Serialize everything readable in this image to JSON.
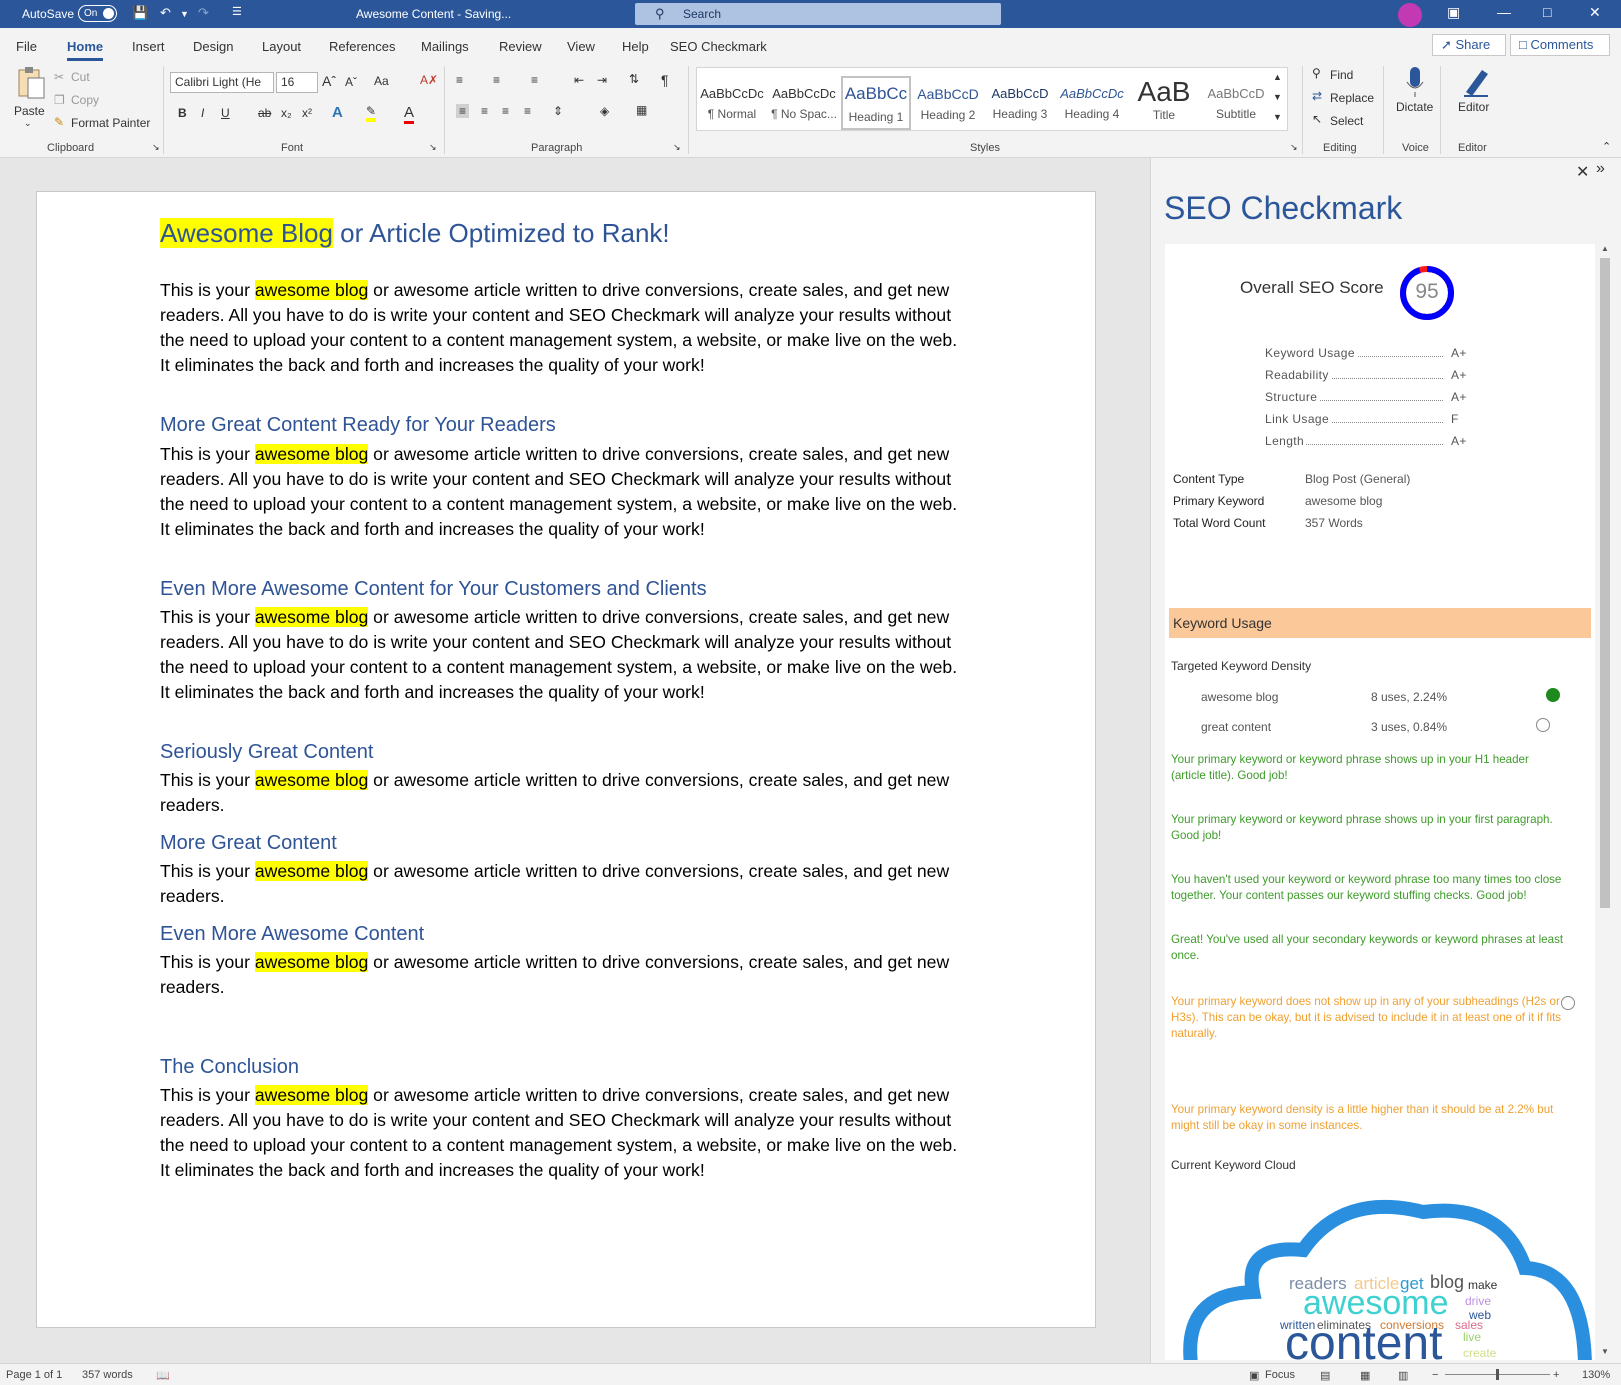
{
  "titlebar": {
    "autosave_label": "AutoSave",
    "autosave_state": "On",
    "doc_title": "Awesome Content - Saving...",
    "search_placeholder": "Search"
  },
  "tabs": [
    "File",
    "Home",
    "Insert",
    "Design",
    "Layout",
    "References",
    "Mailings",
    "Review",
    "View",
    "Help",
    "SEO Checkmark"
  ],
  "share_label": "Share",
  "comments_label": "Comments",
  "ribbon": {
    "clipboard": {
      "paste": "Paste",
      "cut": "Cut",
      "copy": "Copy",
      "format_painter": "Format Painter",
      "label": "Clipboard"
    },
    "font": {
      "name": "Calibri Light (He",
      "size": "16",
      "change_case": "Aa",
      "label": "Font"
    },
    "paragraph": {
      "label": "Paragraph"
    },
    "styles": {
      "label": "Styles",
      "items": [
        {
          "sample": "AaBbCcDc",
          "name": "¶ Normal"
        },
        {
          "sample": "AaBbCcDc",
          "name": "¶ No Spac..."
        },
        {
          "sample": "AaBbCc",
          "name": "Heading 1"
        },
        {
          "sample": "AaBbCcD",
          "name": "Heading 2"
        },
        {
          "sample": "AaBbCcD",
          "name": "Heading 3"
        },
        {
          "sample": "AaBbCcDc",
          "name": "Heading 4"
        },
        {
          "sample": "AaB",
          "name": "Title"
        },
        {
          "sample": "AaBbCcD",
          "name": "Subtitle"
        }
      ]
    },
    "editing": {
      "find": "Find",
      "replace": "Replace",
      "select": "Select",
      "label": "Editing"
    },
    "voice": {
      "dictate": "Dictate",
      "label": "Voice"
    },
    "editor": {
      "editor": "Editor",
      "label": "Editor"
    }
  },
  "document": {
    "title_highlight": "Awesome Blog",
    "title_rest": " or Article Optimized to Rank!",
    "para_pre": "This is your ",
    "keyword": "awesome blog",
    "para_long_rest": " or awesome article written to drive conversions, create sales, and get new readers. All you have to do is write your content and SEO Checkmark will analyze your results without the need to upload your content to a content management system, a website, or make live on the web. It eliminates the back and forth and increases the quality of your work!",
    "para_short_rest": " or awesome article written to drive conversions, create sales, and get new readers.",
    "headings": [
      "More Great Content Ready for Your Readers",
      "Even More Awesome Content for Your Customers and Clients",
      "Seriously Great Content",
      "More Great Content",
      "Even More Awesome Content",
      "The Conclusion"
    ]
  },
  "pane": {
    "title": "SEO Checkmark",
    "overall_label": "Overall SEO Score",
    "score": "95",
    "score_value": 0.95,
    "grades": [
      {
        "label": "Keyword Usage",
        "grade": "A+"
      },
      {
        "label": "Readability",
        "grade": "A+"
      },
      {
        "label": "Structure",
        "grade": "A+"
      },
      {
        "label": "Link Usage",
        "grade": "F"
      },
      {
        "label": "Length",
        "grade": "A+"
      }
    ],
    "info": [
      {
        "label": "Content Type",
        "value": "Blog Post (General)"
      },
      {
        "label": "Primary Keyword",
        "value": "awesome blog"
      },
      {
        "label": "Total Word Count",
        "value": "357 Words"
      }
    ],
    "section_header": "Keyword Usage",
    "density_title": "Targeted Keyword Density",
    "keywords": [
      {
        "name": "awesome blog",
        "stats": "8 uses, 2.24%"
      },
      {
        "name": "great content",
        "stats": "3 uses, 0.84%"
      }
    ],
    "messages": [
      {
        "text": "Your primary keyword or keyword phrase shows up in your H1 header (article title). Good job!",
        "tone": "green"
      },
      {
        "text": "Your primary keyword or keyword phrase shows up in your first paragraph. Good job!",
        "tone": "green"
      },
      {
        "text": "You haven't used your keyword or keyword phrase too many times too close together. Your content passes our keyword stuffing checks. Good job!",
        "tone": "green"
      },
      {
        "text": "Great!  You've used all your secondary keywords or keyword phrases at least once.",
        "tone": "green"
      },
      {
        "text": "Your primary keyword does not show up in any of your subheadings (H2s or H3s).  This can be okay, but it is advised to include it in at least one of it if fits naturally.",
        "tone": "orange"
      },
      {
        "text": "Your primary keyword density is a little higher than it should be at 2.2% but might still be okay in some instances.",
        "tone": "orange"
      }
    ],
    "cloud_title": "Current Keyword Cloud",
    "cloud_words": [
      "readers",
      "article",
      "get",
      "blog",
      "make",
      "awesome",
      "drive",
      "web",
      "written",
      "eliminates",
      "conversions",
      "sales",
      "live",
      "content",
      "create"
    ]
  },
  "status": {
    "page": "Page 1 of 1",
    "words": "357 words",
    "focus": "Focus",
    "zoom": "130%"
  },
  "colors": {
    "accent": "#2b579a",
    "highlight": "#ffff00",
    "heading": "#2f5496",
    "good": "#3f9b2b",
    "warn": "#f0a030",
    "section": "#fbc89a"
  }
}
